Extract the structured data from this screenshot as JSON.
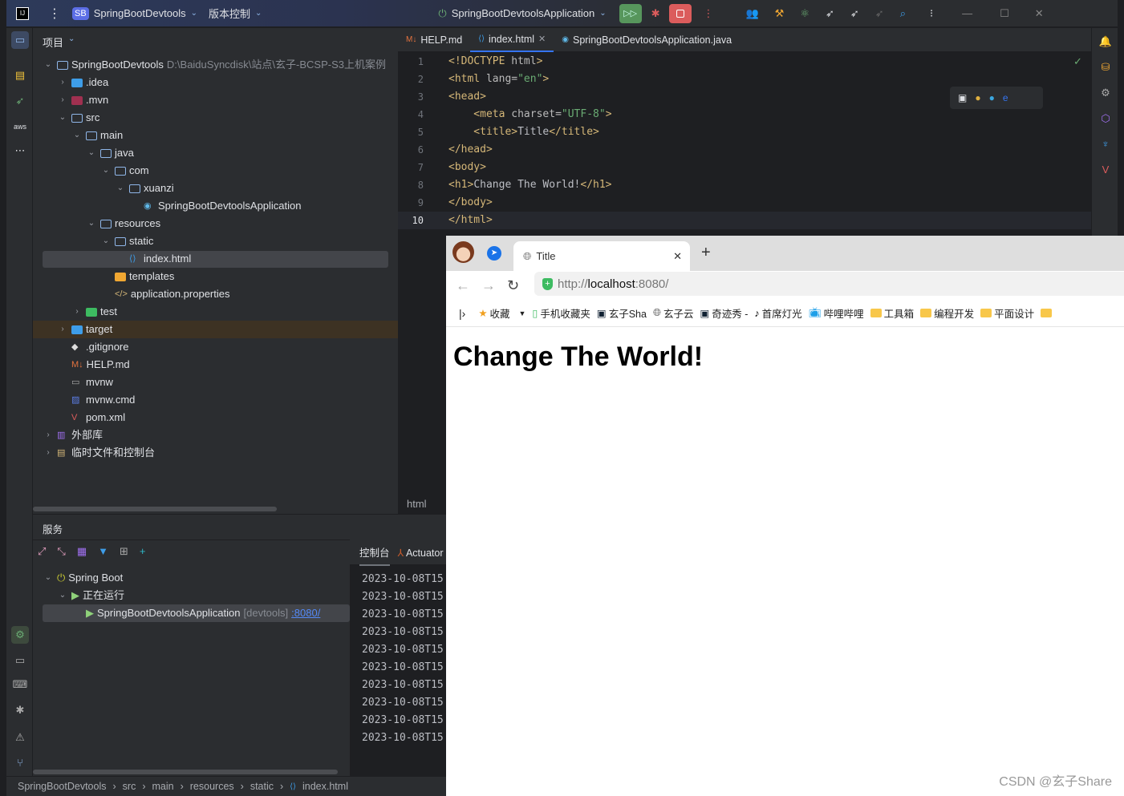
{
  "titlebar": {
    "app_icon": "intellij-icon",
    "project_badge": "SB",
    "project": "SpringBootDevtools",
    "vcs": "版本控制",
    "run_config": "SpringBootDevtoolsApplication"
  },
  "project_panel": {
    "title": "项目",
    "tree": [
      {
        "label": "SpringBootDevtools",
        "path": "D:\\BaiduSyncdisk\\站点\\玄子-BCSP-S3上机案例",
        "level": 0,
        "chev": "down",
        "icon": "folder-icon"
      },
      {
        "label": ".idea",
        "level": 1,
        "chev": "right",
        "icon": "folder-icon"
      },
      {
        "label": ".mvn",
        "level": 1,
        "chev": "right",
        "icon": "folder-icon"
      },
      {
        "label": "src",
        "level": 1,
        "chev": "down",
        "icon": "folder-icon"
      },
      {
        "label": "main",
        "level": 2,
        "chev": "down",
        "icon": "folder-icon"
      },
      {
        "label": "java",
        "level": 3,
        "chev": "down",
        "icon": "folder-icon"
      },
      {
        "label": "com",
        "level": 4,
        "chev": "down",
        "icon": "folder-icon"
      },
      {
        "label": "xuanzi",
        "level": 5,
        "chev": "down",
        "icon": "folder-icon"
      },
      {
        "label": "SpringBootDevtoolsApplication",
        "level": 6,
        "chev": "",
        "icon": "spring-class-icon"
      },
      {
        "label": "resources",
        "level": 3,
        "chev": "down",
        "icon": "folder-icon"
      },
      {
        "label": "static",
        "level": 4,
        "chev": "down",
        "icon": "folder-icon"
      },
      {
        "label": "index.html",
        "level": 5,
        "chev": "",
        "icon": "html-file-icon",
        "selected": true
      },
      {
        "label": "templates",
        "level": 4,
        "chev": "",
        "icon": "folder-icon"
      },
      {
        "label": "application.properties",
        "level": 4,
        "chev": "",
        "icon": "properties-icon"
      },
      {
        "label": "test",
        "level": 2,
        "chev": "right",
        "icon": "folder-icon"
      },
      {
        "label": "target",
        "level": 1,
        "chev": "right",
        "icon": "folder-icon",
        "highlight": true
      },
      {
        "label": ".gitignore",
        "level": 1,
        "chev": "",
        "icon": "git-icon"
      },
      {
        "label": "HELP.md",
        "level": 1,
        "chev": "",
        "icon": "markdown-icon"
      },
      {
        "label": "mvnw",
        "level": 1,
        "chev": "",
        "icon": "terminal-file-icon"
      },
      {
        "label": "mvnw.cmd",
        "level": 1,
        "chev": "",
        "icon": "cmd-file-icon"
      },
      {
        "label": "pom.xml",
        "level": 1,
        "chev": "",
        "icon": "maven-icon"
      },
      {
        "label": "外部库",
        "level": 0,
        "chev": "right",
        "icon": "library-icon"
      },
      {
        "label": "临时文件和控制台",
        "level": 0,
        "chev": "right",
        "icon": "scratch-icon"
      }
    ]
  },
  "editor": {
    "tabs": [
      {
        "label": "HELP.md",
        "icon": "markdown-icon"
      },
      {
        "label": "index.html",
        "icon": "html-file-icon",
        "active": true
      },
      {
        "label": "SpringBootDevtoolsApplication.java",
        "icon": "spring-class-icon"
      }
    ],
    "lines": [
      [
        [
          "tg",
          "<!DOCTYPE "
        ],
        [
          "at",
          "html"
        ],
        [
          "tg",
          ">"
        ]
      ],
      [
        [
          "tg",
          "<html "
        ],
        [
          "at",
          "lang="
        ],
        [
          "st",
          "\"en\""
        ],
        [
          "tg",
          ">"
        ]
      ],
      [
        [
          "tg",
          "<head>"
        ]
      ],
      [
        [
          "tg",
          "    <meta "
        ],
        [
          "at",
          "charset="
        ],
        [
          "st",
          "\"UTF-8\""
        ],
        [
          "tg",
          ">"
        ]
      ],
      [
        [
          "tg",
          "    <title>"
        ],
        [
          "tx",
          "Title"
        ],
        [
          "tg",
          "</title>"
        ]
      ],
      [
        [
          "tg",
          "</head>"
        ]
      ],
      [
        [
          "tg",
          "<body>"
        ]
      ],
      [
        [
          "tg",
          "<h1>"
        ],
        [
          "tx",
          "Change The World!"
        ],
        [
          "tg",
          "</h1>"
        ]
      ],
      [
        [
          "tg",
          "</body>"
        ]
      ],
      [
        [
          "tg",
          "</html>"
        ]
      ]
    ],
    "current_line": 10,
    "breadcrumb": "html"
  },
  "services": {
    "title": "服务",
    "tree": [
      {
        "label": "Spring Boot",
        "level": 0
      },
      {
        "label": "正在运行",
        "level": 1
      },
      {
        "label": "SpringBootDevtoolsApplication",
        "tag": "[devtools]",
        "link": ":8080/",
        "level": 2
      }
    ],
    "console_tabs": [
      "控制台",
      "Actuator"
    ],
    "console_lines": [
      "2023-10-08T15",
      "2023-10-08T15",
      "2023-10-08T15",
      "2023-10-08T15",
      "2023-10-08T15",
      "2023-10-08T15",
      "2023-10-08T15",
      "2023-10-08T15",
      "2023-10-08T15",
      "2023-10-08T15"
    ]
  },
  "statusbar": {
    "crumbs": [
      "SpringBootDevtools",
      "src",
      "main",
      "resources",
      "static",
      "index.html"
    ]
  },
  "browser": {
    "tab_title": "Title",
    "url_prefix": "http://",
    "url_host": "localhost",
    "url_suffix": ":8080/",
    "bookmarks": [
      {
        "label": "收藏",
        "icon": "star-icon"
      },
      {
        "label": "手机收藏夹",
        "icon": "phone-icon"
      },
      {
        "label": "玄子Sha",
        "icon": "site-icon"
      },
      {
        "label": "玄子云",
        "icon": "globe-icon"
      },
      {
        "label": "奇迹秀 -",
        "icon": "site-icon"
      },
      {
        "label": "首席灯光",
        "icon": "tiktok-icon"
      },
      {
        "label": "哔哩哔哩",
        "icon": "bilibili-icon"
      },
      {
        "label": "工具箱",
        "icon": "folder-icon"
      },
      {
        "label": "编程开发",
        "icon": "folder-icon"
      },
      {
        "label": "平面设计",
        "icon": "folder-icon"
      }
    ],
    "heading": "Change The World!"
  },
  "watermark": "CSDN @玄子Share",
  "colors": {
    "accent": "#3574f0",
    "run_green": "#57965c",
    "stop_red": "#db5c5c"
  }
}
